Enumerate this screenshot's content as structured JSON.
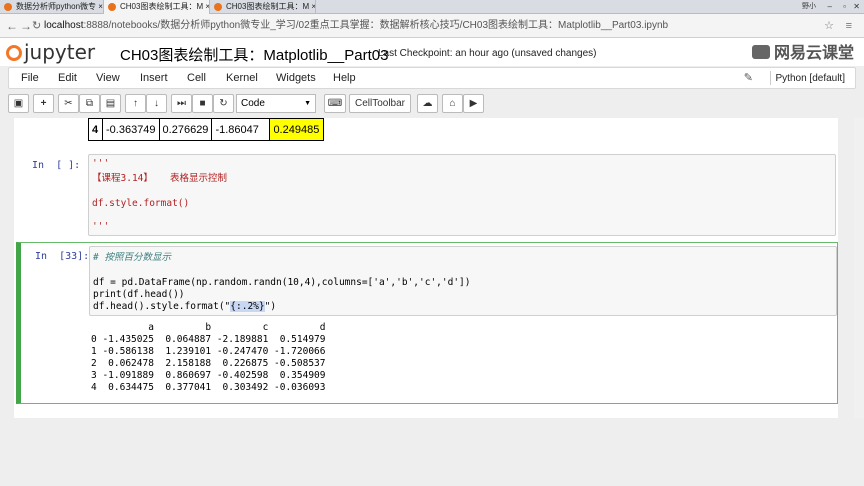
{
  "browser": {
    "tabs": [
      {
        "label": "数据分析师python微专 ×"
      },
      {
        "label": "CH03图表绘制工具：M ×"
      },
      {
        "label": "CH03图表绘制工具：M ×"
      }
    ],
    "user": "野小",
    "url_host": "localhost",
    "url_path": ":8888/notebooks/数据分析师python微专业_学习/02重点工具掌握：数据解析核心技巧/CH03图表绘制工具：Matplotlib__Part03.ipynb"
  },
  "header": {
    "logo": "jupyter",
    "title": "CH03图表绘制工具：Matplotlib__Part03",
    "checkpoint": "Last Checkpoint: an hour ago (unsaved changes)",
    "watermark": "网易云课堂"
  },
  "menu": {
    "items": [
      "File",
      "Edit",
      "View",
      "Insert",
      "Cell",
      "Kernel",
      "Widgets",
      "Help"
    ],
    "kernel": "Python [default]"
  },
  "toolbar": {
    "cell_type": "Code",
    "celltoolbar_label": "CellToolbar"
  },
  "prev_table": {
    "index": "4",
    "values": [
      "-0.363749",
      "0.276629",
      "-1.86047",
      "0.249485"
    ]
  },
  "cells": [
    {
      "prompt": "In  [ ]:",
      "lines": [
        "'''",
        "【课程3.14】   表格显示控制",
        "",
        "df.style.format()",
        "",
        "'''"
      ]
    },
    {
      "prompt": "In  [33]:",
      "comment": "# 按照百分数显示",
      "code1": "df = pd.DataFrame(np.random.randn(10,4),columns=['a','b','c','d'])",
      "code2": "print(df.head())",
      "code3_pre": "df.head().style.format(\"",
      "code3_sel": "{:.2%}",
      "code3_post": "\")",
      "output": [
        "          a         b         c         d",
        "0 -1.435025  0.064887 -2.189881  0.514979",
        "1 -0.586138  1.239101 -0.247470 -1.720066",
        "2  0.062478  2.158188  0.226875 -0.508537",
        "3 -1.091889  0.860697 -0.402598  0.354909",
        "4  0.634475  0.377041  0.303492 -0.036093"
      ]
    }
  ]
}
